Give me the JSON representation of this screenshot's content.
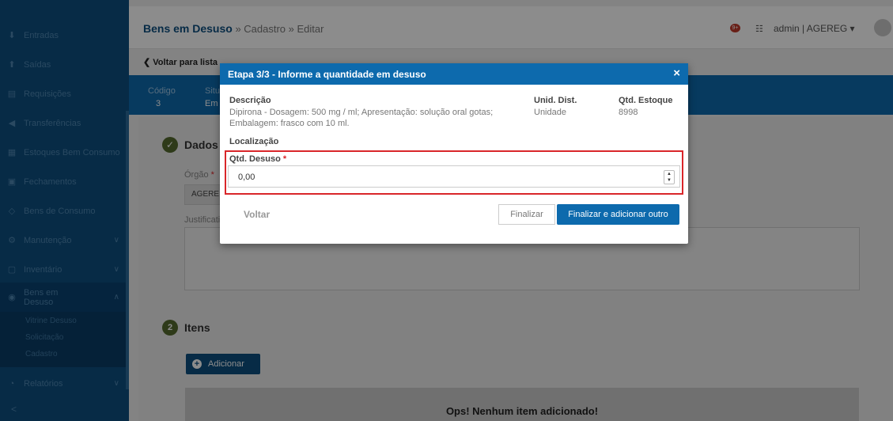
{
  "sidebar": {
    "items": [
      {
        "icon": "arrow-down-icon",
        "glyph": "⬇",
        "label": "Entradas"
      },
      {
        "icon": "arrow-up-icon",
        "glyph": "⬆",
        "label": "Saídas"
      },
      {
        "icon": "file-icon",
        "glyph": "▤",
        "label": "Requisições"
      },
      {
        "icon": "send-icon",
        "glyph": "◀",
        "label": "Transferências"
      },
      {
        "icon": "boxes-icon",
        "glyph": "▦",
        "label": "Estoques Bem Consumo"
      },
      {
        "icon": "calendar-icon",
        "glyph": "▣",
        "label": "Fechamentos"
      },
      {
        "icon": "tag-icon",
        "glyph": "◇",
        "label": "Bens de Consumo"
      },
      {
        "icon": "cogs-icon",
        "glyph": "⚙",
        "label": "Manutenção"
      },
      {
        "icon": "clipboard-icon",
        "glyph": "▢",
        "label": "Inventário"
      },
      {
        "icon": "circle-icon",
        "glyph": "◉",
        "label": "Bens em Desuso"
      },
      {
        "icon": "chart-icon",
        "glyph": "◔",
        "label": "Relatórios"
      }
    ],
    "submenu": [
      "Vitrine Desuso",
      "Solicitação",
      "Cadastro"
    ],
    "collapse_glyph": "<"
  },
  "header": {
    "title": "Bens em Desuso",
    "breadcrumb": " » Cadastro » Editar",
    "notification_count": "9+",
    "user": "admin | AGEREG"
  },
  "back_link": "Voltar para lista",
  "band": {
    "code_label": "Código",
    "code_value": "3",
    "status_label": "Situ",
    "status_value": "Em"
  },
  "form": {
    "section1_title": "Dados",
    "orgao_label": "Órgão",
    "orgao_value": "AGERE",
    "justificativa_label": "Justificati",
    "section2_number": "2",
    "section2_title": "Itens",
    "add_button": "Adicionar",
    "empty_title": "Ops! Nenhum item adicionado!"
  },
  "modal": {
    "title": "Etapa 3/3 - Informe a quantidade em desuso",
    "close": "×",
    "descricao_label": "Descrição",
    "descricao_value": "Dipirona - Dosagem: 500 mg / ml; Apresentação: solução oral gotas; Embalagem: frasco com 10 ml.",
    "unid_label": "Unid. Dist.",
    "unid_value": "Unidade",
    "estoque_label": "Qtd. Estoque",
    "estoque_value": "8998",
    "localizacao_label": "Localização",
    "qtd_label": "Qtd. Desuso",
    "qtd_value": "0,00",
    "voltar": "Voltar",
    "finalizar": "Finalizar",
    "finalizar_add": "Finalizar e adicionar outro"
  }
}
